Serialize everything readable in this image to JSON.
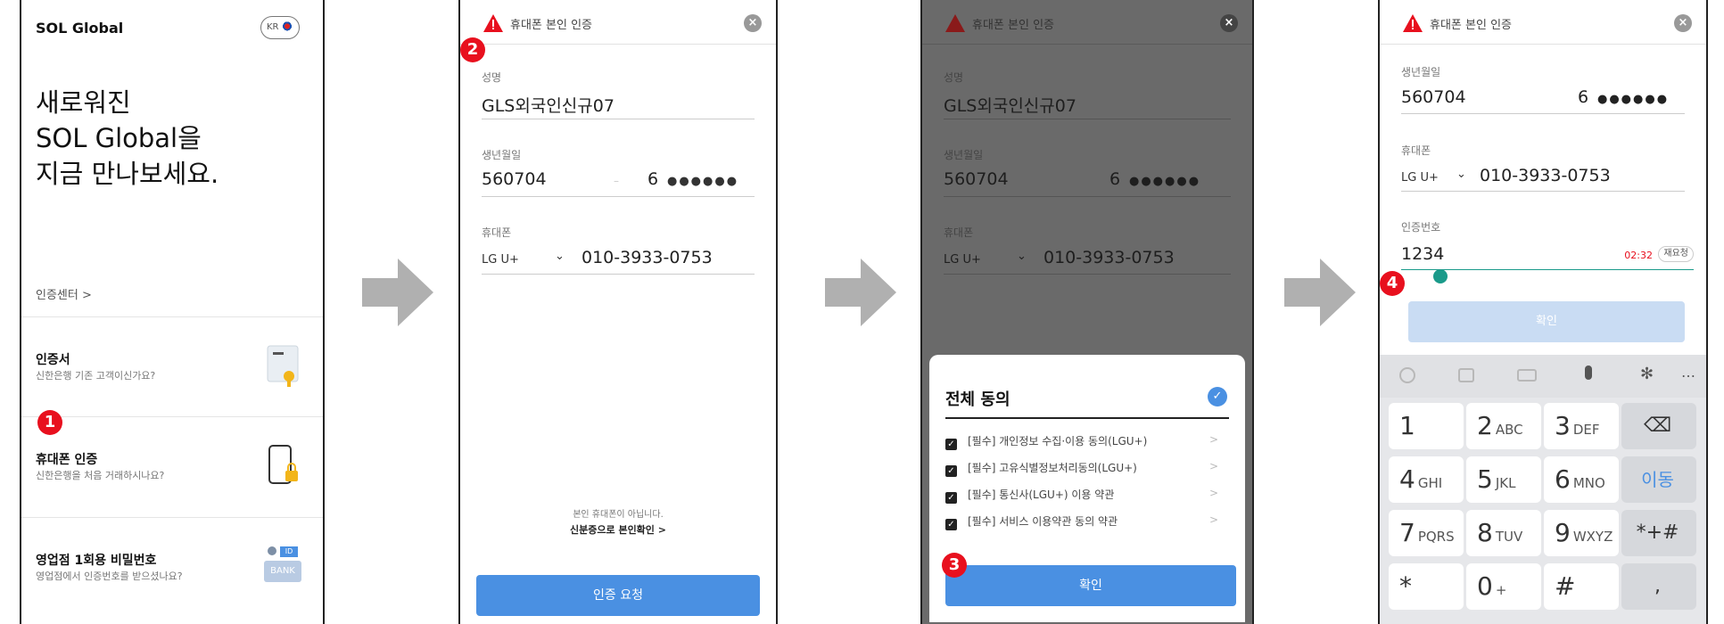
{
  "screen1": {
    "brand": "SOL Global",
    "lang": "KR",
    "headline": [
      "새로워진",
      "SOL Global을",
      "지금 만나보세요."
    ],
    "cert_center": "인증센터  >",
    "items": [
      {
        "title": "인증서",
        "subtitle": "신한은행 기존 고객이신가요?"
      },
      {
        "title": "휴대폰 인증",
        "subtitle": "신한은행을 처음 거래하시나요?"
      },
      {
        "title": "영업점 1회용 비밀번호",
        "subtitle": "영업점에서 인증번호를 받으셨나요?"
      }
    ],
    "bank_icon_text": "BANK",
    "id_icon_text": "ID"
  },
  "steps": [
    "1",
    "2",
    "3",
    "4"
  ],
  "auth": {
    "title": "휴대폰 본인 인증",
    "name_label": "성명",
    "name_value": "GLS외국인신규07",
    "birth_label": "생년월일",
    "birth_value": "560704",
    "birth_dash": "–",
    "gender_digit": "6",
    "masked": "●●●●●●",
    "phone_label": "휴대폰",
    "carrier": "LG U+",
    "carrier_chevron": "⌄",
    "phone_value": "010-3933-0753",
    "not_mine": "본인 휴대폰이 아닙니다.",
    "id_check": "신분증으로 본인확인 >",
    "request_button": "인증 요청"
  },
  "agree": {
    "title": "전체 동의",
    "items": [
      "[필수] 개인정보 수집·이용 동의(LGU+)",
      "[필수] 고유식별정보처리동의(LGU+)",
      "[필수] 통신사(LGU+) 이용 약관",
      "[필수] 서비스 이용약관 동의 약관"
    ],
    "confirm": "확인"
  },
  "verify": {
    "code_label": "인증번호",
    "code_value": "1234",
    "timer": "02:32",
    "resend": "재요청",
    "confirm": "확인"
  },
  "keyboard": {
    "rows": [
      [
        {
          "d": "1",
          "l": ""
        },
        {
          "d": "2",
          "l": "ABC"
        },
        {
          "d": "3",
          "l": "DEF"
        },
        {
          "d": "⌫",
          "l": ""
        }
      ],
      [
        {
          "d": "4",
          "l": "GHI"
        },
        {
          "d": "5",
          "l": "JKL"
        },
        {
          "d": "6",
          "l": "MNO"
        },
        {
          "d": "이동",
          "l": ""
        }
      ],
      [
        {
          "d": "7",
          "l": "PQRS"
        },
        {
          "d": "8",
          "l": "TUV"
        },
        {
          "d": "9",
          "l": "WXYZ"
        },
        {
          "d": "*+#",
          "l": ""
        }
      ],
      [
        {
          "d": "*",
          "l": ""
        },
        {
          "d": "0",
          "l": "+"
        },
        {
          "d": "#",
          "l": ""
        },
        {
          "d": ",",
          "l": ""
        }
      ]
    ]
  },
  "colors": {
    "accent": "#4a90e2",
    "badge": "#e8101e",
    "teal": "#1a9a8a"
  }
}
